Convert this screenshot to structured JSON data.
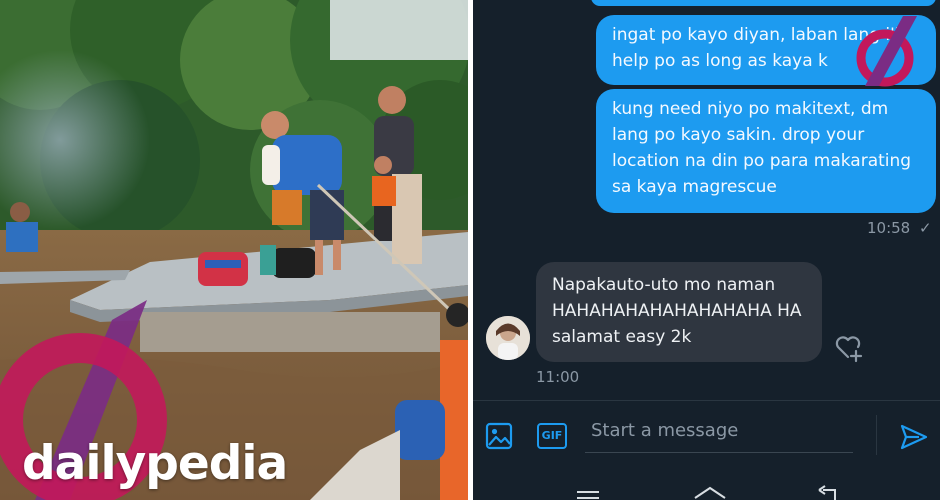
{
  "brand": {
    "name": "dailypedia"
  },
  "photo": {
    "description_icon": "flood-rescue-photo"
  },
  "chat": {
    "messages": [
      {
        "direction": "out",
        "text": "ingat po kayo diyan, laban lang i'll help po as long as kaya k"
      },
      {
        "direction": "out",
        "text": "kung need niyo po makitext, dm lang po kayo sakin. drop your location na din po para makarating sa kaya magrescue",
        "time": "10:58"
      },
      {
        "direction": "in",
        "text": "Napakauto-uto mo naman HAHAHAHAHAHAHAHAHA HA salamat easy 2k",
        "time": "11:00"
      }
    ],
    "composer": {
      "placeholder": "Start a message",
      "gif_label": "GIF"
    }
  },
  "colors": {
    "chat_bg": "#15202b",
    "bubble_out": "#1d9bf0",
    "bubble_in": "#2f3640",
    "brand_accent": "#c2185b"
  }
}
